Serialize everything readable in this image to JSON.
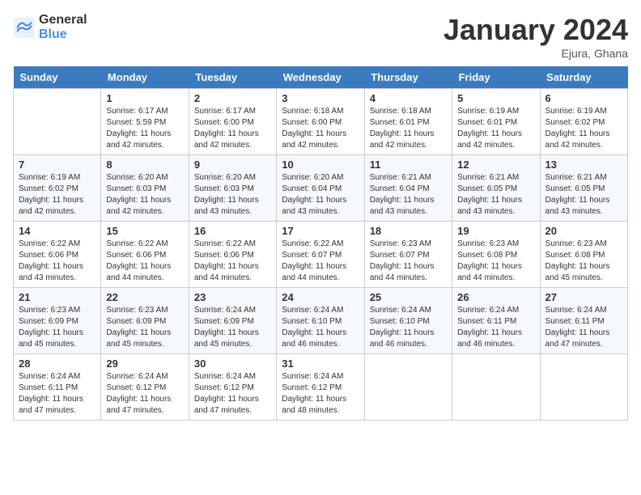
{
  "header": {
    "logo_general": "General",
    "logo_blue": "Blue",
    "month_title": "January 2024",
    "location": "Ejura, Ghana"
  },
  "days_of_week": [
    "Sunday",
    "Monday",
    "Tuesday",
    "Wednesday",
    "Thursday",
    "Friday",
    "Saturday"
  ],
  "weeks": [
    [
      {
        "day": "",
        "sunrise": "",
        "sunset": "",
        "daylight": ""
      },
      {
        "day": "1",
        "sunrise": "Sunrise: 6:17 AM",
        "sunset": "Sunset: 5:59 PM",
        "daylight": "Daylight: 11 hours and 42 minutes."
      },
      {
        "day": "2",
        "sunrise": "Sunrise: 6:17 AM",
        "sunset": "Sunset: 6:00 PM",
        "daylight": "Daylight: 11 hours and 42 minutes."
      },
      {
        "day": "3",
        "sunrise": "Sunrise: 6:18 AM",
        "sunset": "Sunset: 6:00 PM",
        "daylight": "Daylight: 11 hours and 42 minutes."
      },
      {
        "day": "4",
        "sunrise": "Sunrise: 6:18 AM",
        "sunset": "Sunset: 6:01 PM",
        "daylight": "Daylight: 11 hours and 42 minutes."
      },
      {
        "day": "5",
        "sunrise": "Sunrise: 6:19 AM",
        "sunset": "Sunset: 6:01 PM",
        "daylight": "Daylight: 11 hours and 42 minutes."
      },
      {
        "day": "6",
        "sunrise": "Sunrise: 6:19 AM",
        "sunset": "Sunset: 6:02 PM",
        "daylight": "Daylight: 11 hours and 42 minutes."
      }
    ],
    [
      {
        "day": "7",
        "sunrise": "Sunrise: 6:19 AM",
        "sunset": "Sunset: 6:02 PM",
        "daylight": "Daylight: 11 hours and 42 minutes."
      },
      {
        "day": "8",
        "sunrise": "Sunrise: 6:20 AM",
        "sunset": "Sunset: 6:03 PM",
        "daylight": "Daylight: 11 hours and 42 minutes."
      },
      {
        "day": "9",
        "sunrise": "Sunrise: 6:20 AM",
        "sunset": "Sunset: 6:03 PM",
        "daylight": "Daylight: 11 hours and 43 minutes."
      },
      {
        "day": "10",
        "sunrise": "Sunrise: 6:20 AM",
        "sunset": "Sunset: 6:04 PM",
        "daylight": "Daylight: 11 hours and 43 minutes."
      },
      {
        "day": "11",
        "sunrise": "Sunrise: 6:21 AM",
        "sunset": "Sunset: 6:04 PM",
        "daylight": "Daylight: 11 hours and 43 minutes."
      },
      {
        "day": "12",
        "sunrise": "Sunrise: 6:21 AM",
        "sunset": "Sunset: 6:05 PM",
        "daylight": "Daylight: 11 hours and 43 minutes."
      },
      {
        "day": "13",
        "sunrise": "Sunrise: 6:21 AM",
        "sunset": "Sunset: 6:05 PM",
        "daylight": "Daylight: 11 hours and 43 minutes."
      }
    ],
    [
      {
        "day": "14",
        "sunrise": "Sunrise: 6:22 AM",
        "sunset": "Sunset: 6:06 PM",
        "daylight": "Daylight: 11 hours and 43 minutes."
      },
      {
        "day": "15",
        "sunrise": "Sunrise: 6:22 AM",
        "sunset": "Sunset: 6:06 PM",
        "daylight": "Daylight: 11 hours and 44 minutes."
      },
      {
        "day": "16",
        "sunrise": "Sunrise: 6:22 AM",
        "sunset": "Sunset: 6:06 PM",
        "daylight": "Daylight: 11 hours and 44 minutes."
      },
      {
        "day": "17",
        "sunrise": "Sunrise: 6:22 AM",
        "sunset": "Sunset: 6:07 PM",
        "daylight": "Daylight: 11 hours and 44 minutes."
      },
      {
        "day": "18",
        "sunrise": "Sunrise: 6:23 AM",
        "sunset": "Sunset: 6:07 PM",
        "daylight": "Daylight: 11 hours and 44 minutes."
      },
      {
        "day": "19",
        "sunrise": "Sunrise: 6:23 AM",
        "sunset": "Sunset: 6:08 PM",
        "daylight": "Daylight: 11 hours and 44 minutes."
      },
      {
        "day": "20",
        "sunrise": "Sunrise: 6:23 AM",
        "sunset": "Sunset: 6:08 PM",
        "daylight": "Daylight: 11 hours and 45 minutes."
      }
    ],
    [
      {
        "day": "21",
        "sunrise": "Sunrise: 6:23 AM",
        "sunset": "Sunset: 6:09 PM",
        "daylight": "Daylight: 11 hours and 45 minutes."
      },
      {
        "day": "22",
        "sunrise": "Sunrise: 6:23 AM",
        "sunset": "Sunset: 6:09 PM",
        "daylight": "Daylight: 11 hours and 45 minutes."
      },
      {
        "day": "23",
        "sunrise": "Sunrise: 6:24 AM",
        "sunset": "Sunset: 6:09 PM",
        "daylight": "Daylight: 11 hours and 45 minutes."
      },
      {
        "day": "24",
        "sunrise": "Sunrise: 6:24 AM",
        "sunset": "Sunset: 6:10 PM",
        "daylight": "Daylight: 11 hours and 46 minutes."
      },
      {
        "day": "25",
        "sunrise": "Sunrise: 6:24 AM",
        "sunset": "Sunset: 6:10 PM",
        "daylight": "Daylight: 11 hours and 46 minutes."
      },
      {
        "day": "26",
        "sunrise": "Sunrise: 6:24 AM",
        "sunset": "Sunset: 6:11 PM",
        "daylight": "Daylight: 11 hours and 46 minutes."
      },
      {
        "day": "27",
        "sunrise": "Sunrise: 6:24 AM",
        "sunset": "Sunset: 6:11 PM",
        "daylight": "Daylight: 11 hours and 47 minutes."
      }
    ],
    [
      {
        "day": "28",
        "sunrise": "Sunrise: 6:24 AM",
        "sunset": "Sunset: 6:11 PM",
        "daylight": "Daylight: 11 hours and 47 minutes."
      },
      {
        "day": "29",
        "sunrise": "Sunrise: 6:24 AM",
        "sunset": "Sunset: 6:12 PM",
        "daylight": "Daylight: 11 hours and 47 minutes."
      },
      {
        "day": "30",
        "sunrise": "Sunrise: 6:24 AM",
        "sunset": "Sunset: 6:12 PM",
        "daylight": "Daylight: 11 hours and 47 minutes."
      },
      {
        "day": "31",
        "sunrise": "Sunrise: 6:24 AM",
        "sunset": "Sunset: 6:12 PM",
        "daylight": "Daylight: 11 hours and 48 minutes."
      },
      {
        "day": "",
        "sunrise": "",
        "sunset": "",
        "daylight": ""
      },
      {
        "day": "",
        "sunrise": "",
        "sunset": "",
        "daylight": ""
      },
      {
        "day": "",
        "sunrise": "",
        "sunset": "",
        "daylight": ""
      }
    ]
  ]
}
